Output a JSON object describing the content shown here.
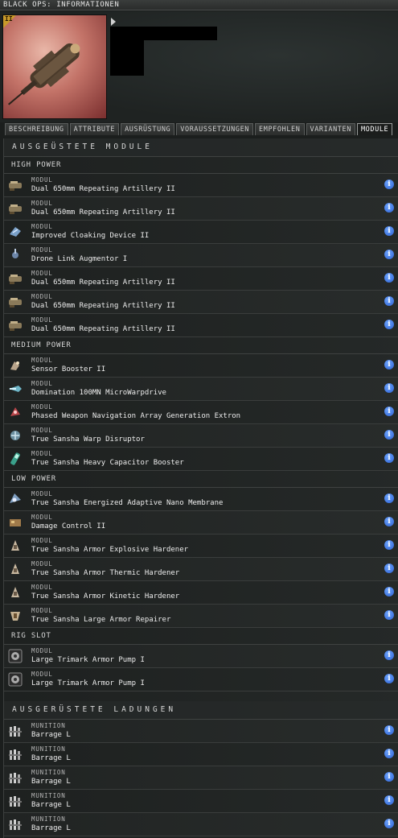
{
  "window": {
    "title": "BLACK OPS: INFORMATIONEN"
  },
  "ship": {
    "tech_badge": "II"
  },
  "tabs": [
    {
      "label": "BESCHREIBUNG",
      "active": false
    },
    {
      "label": "ATTRIBUTE",
      "active": false
    },
    {
      "label": "AUSRÜSTUNG",
      "active": false
    },
    {
      "label": "VORAUSSETZUNGEN",
      "active": false
    },
    {
      "label": "EMPFOHLEN",
      "active": false
    },
    {
      "label": "VARIANTEN",
      "active": false
    },
    {
      "label": "MODULE",
      "active": true
    }
  ],
  "modules": {
    "title": "AUSGEÜSTETE MODULE",
    "groups": [
      {
        "name": "HIGH POWER",
        "items": [
          {
            "cat": "MODUL",
            "name": "Dual 650mm Repeating Artillery II",
            "icon": "artillery-icon"
          },
          {
            "cat": "MODUL",
            "name": "Dual 650mm Repeating Artillery II",
            "icon": "artillery-icon"
          },
          {
            "cat": "MODUL",
            "name": "Improved Cloaking Device II",
            "icon": "cloak-icon"
          },
          {
            "cat": "MODUL",
            "name": "Drone Link Augmentor I",
            "icon": "drone-link-icon"
          },
          {
            "cat": "MODUL",
            "name": "Dual 650mm Repeating Artillery II",
            "icon": "artillery-icon"
          },
          {
            "cat": "MODUL",
            "name": "Dual 650mm Repeating Artillery II",
            "icon": "artillery-icon"
          },
          {
            "cat": "MODUL",
            "name": "Dual 650mm Repeating Artillery II",
            "icon": "artillery-icon"
          }
        ]
      },
      {
        "name": "MEDIUM POWER",
        "items": [
          {
            "cat": "MODUL",
            "name": "Sensor Booster II",
            "icon": "sensor-booster-icon"
          },
          {
            "cat": "MODUL",
            "name": "Domination 100MN MicroWarpdrive",
            "icon": "microwarpdrive-icon"
          },
          {
            "cat": "MODUL",
            "name": "Phased Weapon Navigation Array Generation Extron",
            "icon": "web-icon"
          },
          {
            "cat": "MODUL",
            "name": "True Sansha Warp Disruptor",
            "icon": "warp-disruptor-icon"
          },
          {
            "cat": "MODUL",
            "name": "True Sansha Heavy Capacitor Booster",
            "icon": "cap-booster-icon"
          }
        ]
      },
      {
        "name": "LOW POWER",
        "items": [
          {
            "cat": "MODUL",
            "name": "True Sansha Energized Adaptive Nano Membrane",
            "icon": "membrane-icon"
          },
          {
            "cat": "MODUL",
            "name": "Damage Control II",
            "icon": "damage-control-icon"
          },
          {
            "cat": "MODUL",
            "name": "True Sansha Armor Explosive Hardener",
            "icon": "hardener-icon"
          },
          {
            "cat": "MODUL",
            "name": "True Sansha Armor Thermic Hardener",
            "icon": "hardener-icon"
          },
          {
            "cat": "MODUL",
            "name": "True Sansha Armor Kinetic Hardener",
            "icon": "hardener-icon"
          },
          {
            "cat": "MODUL",
            "name": "True Sansha Large Armor Repairer",
            "icon": "armor-repairer-icon"
          }
        ]
      },
      {
        "name": "RIG SLOT",
        "items": [
          {
            "cat": "MODUL",
            "name": "Large Trimark Armor Pump I",
            "icon": "rig-icon"
          },
          {
            "cat": "MODUL",
            "name": "Large Trimark Armor Pump I",
            "icon": "rig-icon"
          }
        ]
      }
    ]
  },
  "charges": {
    "title": "AUSGERÜSTETE LADUNGEN",
    "items": [
      {
        "cat": "MUNITION",
        "name": "Barrage L",
        "icon": "ammo-icon"
      },
      {
        "cat": "MUNITION",
        "name": "Barrage L",
        "icon": "ammo-icon"
      },
      {
        "cat": "MUNITION",
        "name": "Barrage L",
        "icon": "ammo-icon"
      },
      {
        "cat": "MUNITION",
        "name": "Barrage L",
        "icon": "ammo-icon"
      },
      {
        "cat": "MUNITION",
        "name": "Barrage L",
        "icon": "ammo-icon"
      }
    ]
  },
  "info_glyph": "i"
}
